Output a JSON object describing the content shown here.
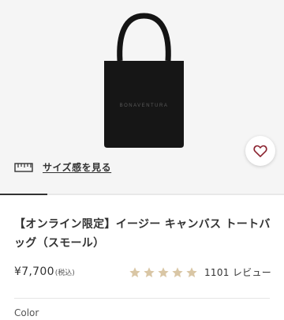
{
  "gallery": {
    "bag_print": "BONAVENTURA",
    "size_link_label": "サイズ感を見る",
    "icons": {
      "size": "ruler-icon",
      "favorite": "heart-icon"
    },
    "favorite_color": "#8b2330"
  },
  "product": {
    "title": "【オンライン限定】イージー キャンバス トートバッグ（スモール）",
    "price": "¥7,700",
    "tax_note": "(税込)",
    "rating_stars": 5,
    "review_count": "1101 レビュー",
    "star_color": "#d9c6a5"
  },
  "options": {
    "color_label": "Color"
  }
}
